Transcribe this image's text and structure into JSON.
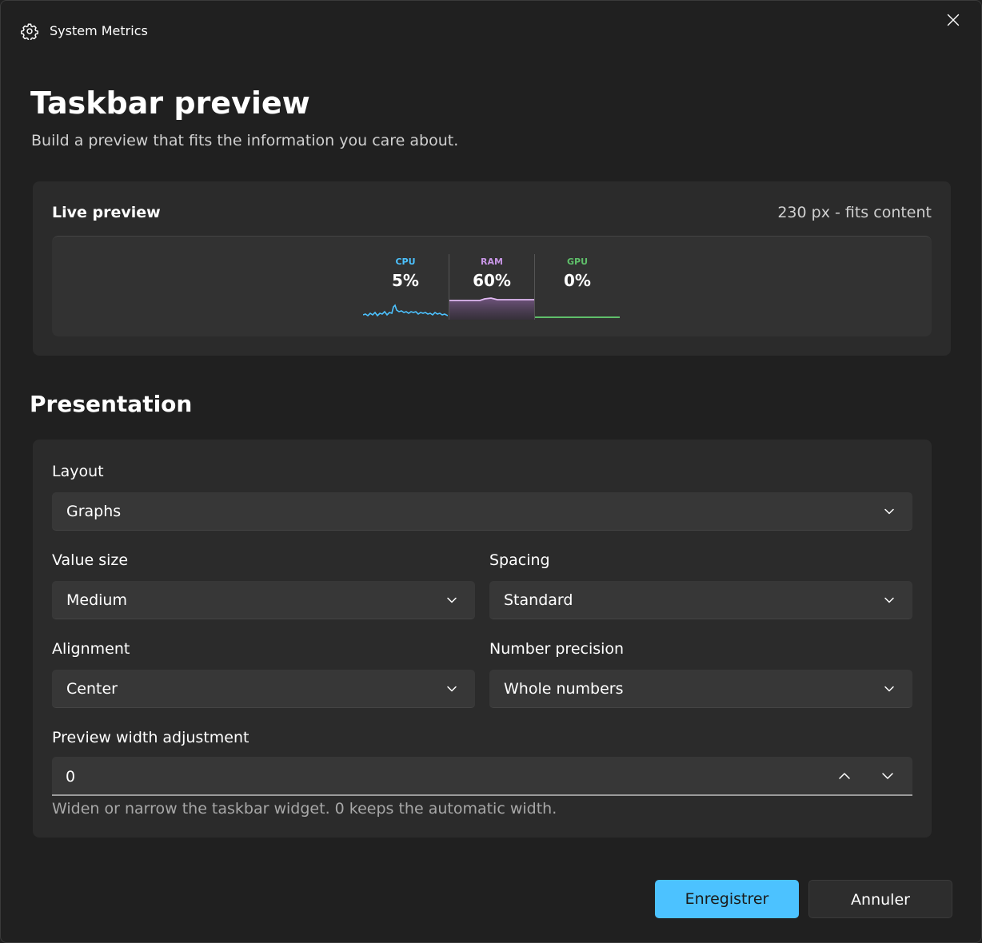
{
  "window": {
    "title": "System Metrics",
    "icon": "gear-icon"
  },
  "header": {
    "title": "Taskbar preview",
    "subtitle": "Build a preview that fits the information you care about."
  },
  "live_preview": {
    "title": "Live preview",
    "width_info": "230 px - fits content",
    "metrics": [
      {
        "label": "CPU",
        "value": "5%",
        "color": "#4cc2ff"
      },
      {
        "label": "RAM",
        "value": "60%",
        "color": "#c896e6"
      },
      {
        "label": "GPU",
        "value": "0%",
        "color": "#5fbf6a"
      }
    ]
  },
  "presentation": {
    "title": "Presentation",
    "layout": {
      "label": "Layout",
      "value": "Graphs"
    },
    "value_size": {
      "label": "Value size",
      "value": "Medium"
    },
    "spacing": {
      "label": "Spacing",
      "value": "Standard"
    },
    "alignment": {
      "label": "Alignment",
      "value": "Center"
    },
    "number_precision": {
      "label": "Number precision",
      "value": "Whole numbers"
    },
    "preview_width": {
      "label": "Preview width adjustment",
      "value": "0",
      "helper": "Widen or narrow the taskbar widget. 0 keeps the automatic width."
    }
  },
  "footer": {
    "save_label": "Enregistrer",
    "cancel_label": "Annuler"
  },
  "colors": {
    "accent": "#4cc2ff",
    "background": "#202020",
    "card": "#2b2b2b"
  }
}
